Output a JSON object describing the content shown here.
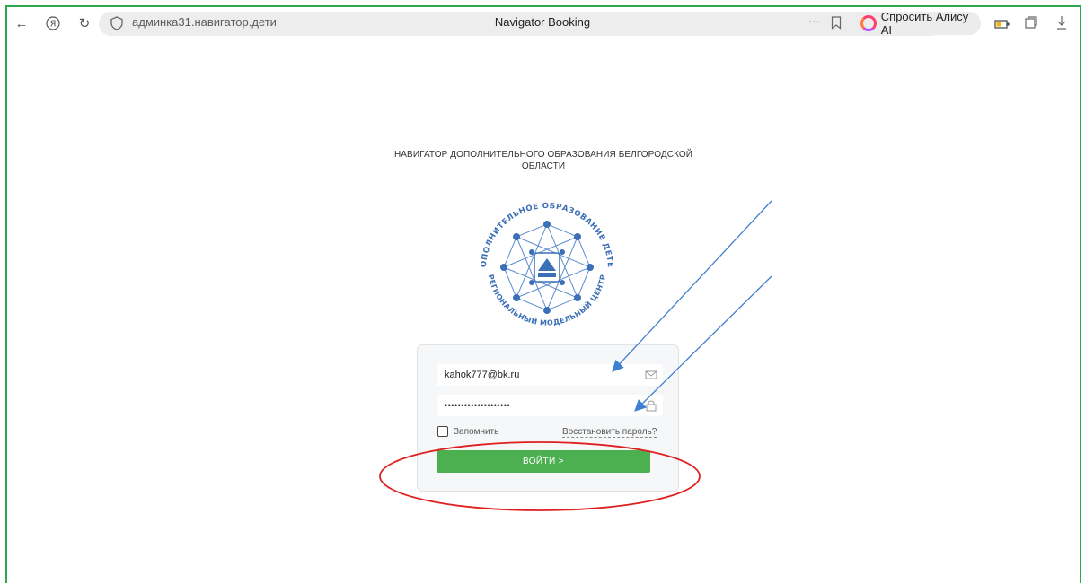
{
  "browser": {
    "url": "админка31.навигатор.дети",
    "tab_title": "Navigator Booking",
    "alice_label": "Спросить Алису AI"
  },
  "page": {
    "heading": "НАВИГАТОР ДОПОЛНИТЕЛЬНОГО ОБРАЗОВАНИЯ БЕЛГОРОДСКОЙ ОБЛАСТИ",
    "emblem_text_top": "ДОПОЛНИТЕЛЬНОЕ ОБРАЗОВАНИЕ ДЕТЕЙ",
    "emblem_text_bottom": "РЕГИОНАЛЬНЫЙ МОДЕЛЬНЫЙ ЦЕНТР"
  },
  "login": {
    "email_value": "kahok777@bk.ru",
    "password_value": "••••••••••••••••••••",
    "remember_label": "Запомнить",
    "restore_label": "Восстановить пароль?",
    "submit_label": "ВОЙТИ >"
  },
  "colors": {
    "frame": "#2ea84a",
    "button": "#4caf50",
    "arrow": "#3f7fd0",
    "ellipse": "#e02020",
    "emblem": "#3b6fb6"
  }
}
